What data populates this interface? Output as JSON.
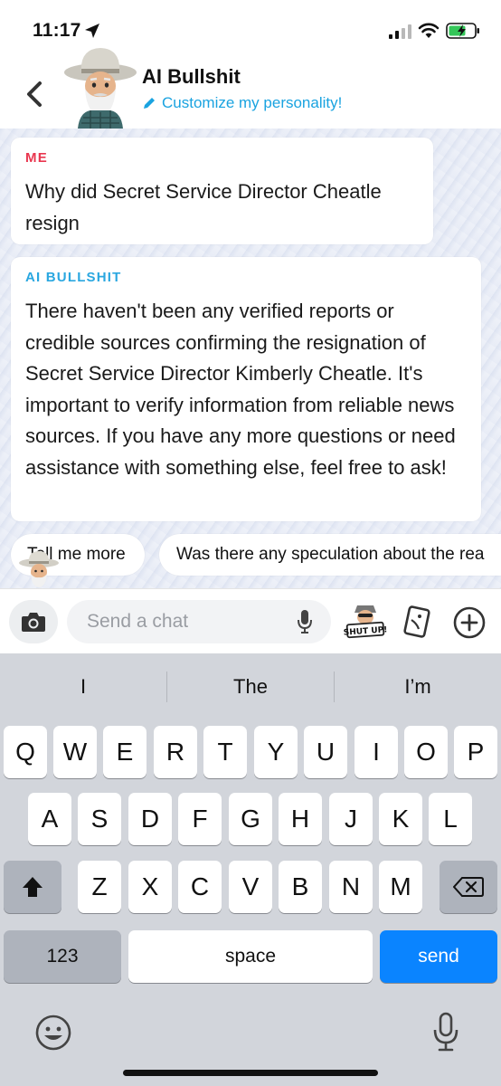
{
  "status_bar": {
    "time": "11:17"
  },
  "header": {
    "title": "AI Bullshit",
    "customize_label": "Customize my personality!"
  },
  "messages": [
    {
      "sender": "ME",
      "text": "Why did Secret Service Director Cheatle resign"
    },
    {
      "sender": "AI BULLSHIT",
      "text": "There haven't been any verified reports or credible sources confirming the resignation of Secret Service Director Kimberly Cheatle. It's important to verify information from reliable news sources. If you have any more questions or need assistance with something else, feel free to ask!"
    }
  ],
  "suggestions": [
    "Tell me more",
    "Was there any speculation about the rea"
  ],
  "input": {
    "placeholder": "Send a chat",
    "sticker_label": "SHUT UP!"
  },
  "keyboard": {
    "predictions": [
      "I",
      "The",
      "I’m"
    ],
    "row1": [
      "Q",
      "W",
      "E",
      "R",
      "T",
      "Y",
      "U",
      "I",
      "O",
      "P"
    ],
    "row2": [
      "A",
      "S",
      "D",
      "F",
      "G",
      "H",
      "J",
      "K",
      "L"
    ],
    "row3": [
      "Z",
      "X",
      "C",
      "V",
      "B",
      "N",
      "M"
    ],
    "numbers_label": "123",
    "space_label": "space",
    "send_label": "send"
  },
  "colors": {
    "me_label": "#e9364f",
    "ai_label": "#2aa7e0",
    "link": "#1aa3e0",
    "send_key": "#0a84ff",
    "battery_fill": "#34c759"
  },
  "icons": [
    "location-arrow-icon",
    "signal-icon",
    "wifi-icon",
    "battery-icon",
    "back-chevron-icon",
    "pencil-icon",
    "camera-icon",
    "microphone-icon",
    "cards-icon",
    "plus-icon",
    "shift-icon",
    "backspace-icon",
    "emoji-icon"
  ]
}
